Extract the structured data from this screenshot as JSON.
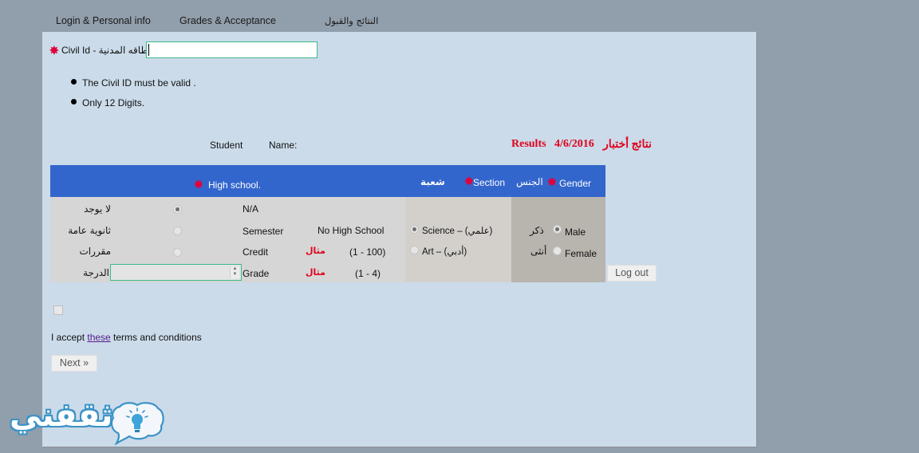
{
  "tabs": [
    {
      "label": "Login & Personal info"
    },
    {
      "label": "Grades & Acceptance"
    },
    {
      "label": "النتائج والقبول"
    }
  ],
  "civil_id": {
    "label": "Civil Id - البطاقه المدنية",
    "value": "",
    "required_icon": "asterisk-icon"
  },
  "rules": [
    "The Civil ID must be valid .",
    "Only 12 Digits."
  ],
  "student": {
    "student_label": "Student",
    "name_label": "Name:",
    "name_value": ""
  },
  "results_title": {
    "en": "Results",
    "date": "4/6/2016",
    "ar": "نتائج أختبار",
    "color": "#e0001c"
  },
  "table": {
    "header": {
      "high_school": "High school.",
      "section_ar": "شعبة",
      "section": "Section",
      "gender_ar": "الجنس",
      "gender": "Gender",
      "color": "#3366cc"
    },
    "high_school_rows": [
      {
        "label_ar": "لا يوجد",
        "label_en": "N/A",
        "checked": true
      },
      {
        "label_ar": "ثانوية عامة",
        "label_en": "Semester",
        "checked": false,
        "info": "No High School"
      },
      {
        "label_ar": "مقررات",
        "label_en": "Credit",
        "checked": false,
        "example": "مثال",
        "range": "(1 - 100)"
      },
      {
        "label_ar": "الدرجة",
        "label_en": "Grade",
        "value": "",
        "example": "مثال",
        "range": "(1 - 4)"
      }
    ],
    "section_options": [
      {
        "label": "Science – (علمي)",
        "checked": true
      },
      {
        "label": "Art – (أدبي)",
        "checked": false
      }
    ],
    "gender_options": [
      {
        "label_ar": "ذكر",
        "label": "Male",
        "checked": true
      },
      {
        "label_ar": "أنثى",
        "label": "Female",
        "checked": false
      }
    ]
  },
  "logout_button": "Log out",
  "terms": {
    "checked": false,
    "prefix": "I accept ",
    "link": "these",
    "suffix": " terms and conditions"
  },
  "next_button": "Next »",
  "watermark": {
    "text": "ثقفني",
    "icon": "lightbulb-speech-bubble-icon"
  }
}
